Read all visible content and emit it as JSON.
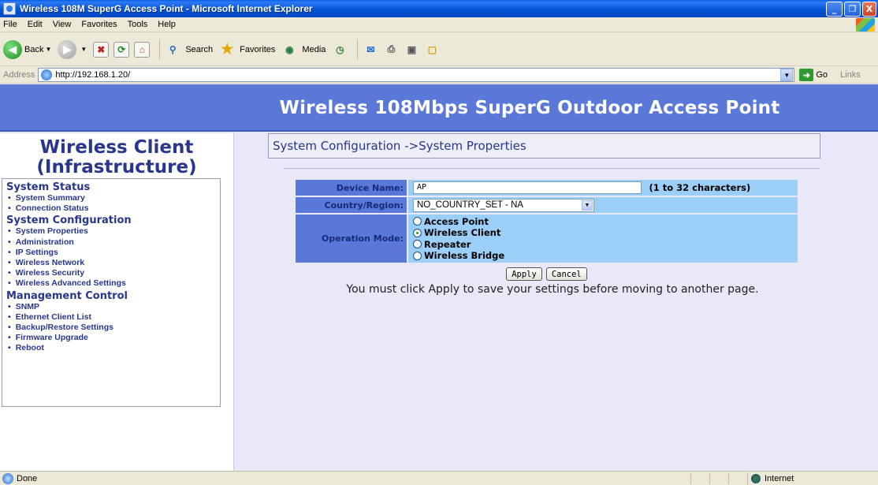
{
  "window": {
    "title": "Wireless 108M SuperG Access Point - Microsoft Internet Explorer",
    "minimize": "_",
    "restore": "❐",
    "close": "X"
  },
  "menu": [
    "File",
    "Edit",
    "View",
    "Favorites",
    "Tools",
    "Help"
  ],
  "toolbar": {
    "back": "Back",
    "search": "Search",
    "favorites": "Favorites",
    "media": "Media"
  },
  "address": {
    "label": "Address",
    "url": "http://192.168.1.20/",
    "go": "Go",
    "links": "Links"
  },
  "page": {
    "banner": "Wireless 108Mbps SuperG Outdoor Access Point",
    "sidebar_title_1": "Wireless Client",
    "sidebar_title_2": "(Infrastructure)",
    "nav": {
      "status_head": "System Status",
      "status_items": [
        "System Summary",
        "Connection Status"
      ],
      "config_head": "System Configuration",
      "config_items": [
        "System Properties",
        "Administration",
        "IP Settings",
        "Wireless Network",
        "Wireless Security",
        "Wireless Advanced Settings"
      ],
      "mgmt_head": "Management Control",
      "mgmt_items": [
        "SNMP",
        "Ethernet Client List",
        "Backup/Restore Settings",
        "Firmware Upgrade",
        "Reboot"
      ]
    },
    "breadcrumb": "System Configuration ->System Properties",
    "form": {
      "device_name_label": "Device Name:",
      "device_name_value": "AP",
      "device_name_hint": "(1 to 32 characters)",
      "country_label": "Country/Region:",
      "country_value": "NO_COUNTRY_SET - NA",
      "mode_label": "Operation Mode:",
      "modes": [
        "Access Point",
        "Wireless Client",
        "Repeater",
        "Wireless Bridge"
      ],
      "selected_mode": "Wireless Client"
    },
    "apply": "Apply",
    "cancel": "Cancel",
    "note": "You must click Apply to save your settings before moving to another page."
  },
  "status": {
    "text": "Done",
    "zone": "Internet"
  }
}
